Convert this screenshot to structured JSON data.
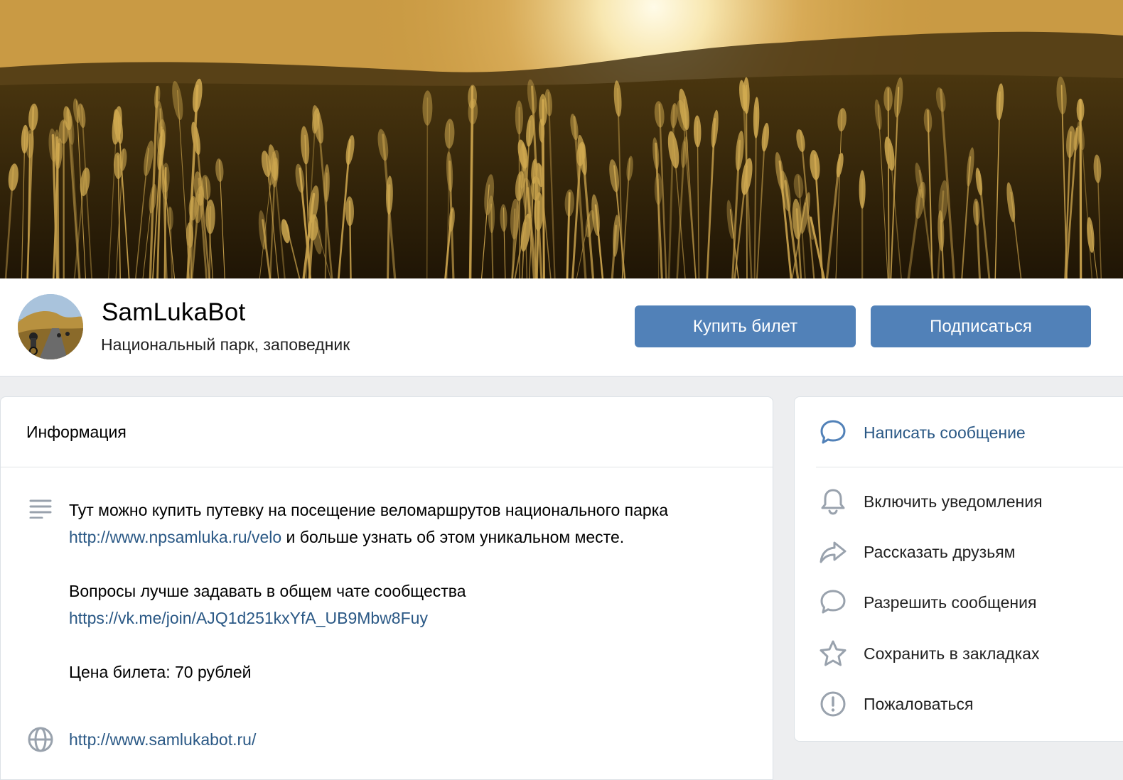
{
  "community": {
    "name": "SamLukaBot",
    "category": "Национальный парк, заповедник"
  },
  "header_buttons": {
    "buy_label": "Купить билет",
    "subscribe_label": "Подписаться"
  },
  "info": {
    "heading": "Информация",
    "para1_text_a": "Тут можно купить путевку на посещение веломаршрутов национального парка ",
    "para1_link": "http://www.npsamluka.ru/velo",
    "para1_text_b": " и больше узнать об этом уникальном месте.",
    "para2_text": "Вопросы лучше задавать в общем чате сообщества",
    "para2_link": "https://vk.me/join/AJQ1d251kxYfA_UB9Mbw8Fuy",
    "price_text": "Цена билета: 70 рублей",
    "website": "http://www.samlukabot.ru/"
  },
  "actions": [
    {
      "label": "Написать сообщение",
      "icon": "message-icon"
    },
    {
      "label": "Включить уведомления",
      "icon": "bell-icon"
    },
    {
      "label": "Рассказать друзьям",
      "icon": "share-icon"
    },
    {
      "label": "Разрешить сообщения",
      "icon": "chat-bubble-icon"
    },
    {
      "label": "Сохранить в закладках",
      "icon": "star-icon"
    },
    {
      "label": "Пожаловаться",
      "icon": "report-icon"
    }
  ],
  "colors": {
    "accent_button": "#5181b8",
    "link": "#2a5885",
    "page_bg": "#edeef0"
  }
}
